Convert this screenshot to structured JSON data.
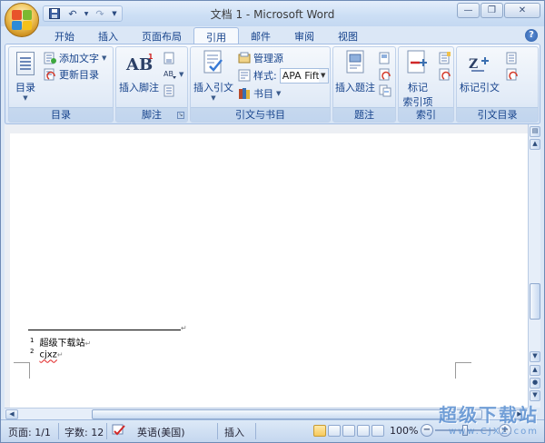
{
  "window": {
    "title": "文档 1 - Microsoft Word",
    "controls": [
      "minimize-icon",
      "restore-icon",
      "close-icon"
    ]
  },
  "quick_access": {
    "icons": [
      "save-icon",
      "undo-icon",
      "redo-icon",
      "customize-dropdown-icon"
    ]
  },
  "tabs": [
    {
      "label": "开始",
      "active": false
    },
    {
      "label": "插入",
      "active": false
    },
    {
      "label": "页面布局",
      "active": false
    },
    {
      "label": "引用",
      "active": true
    },
    {
      "label": "邮件",
      "active": false
    },
    {
      "label": "审阅",
      "active": false
    },
    {
      "label": "视图",
      "active": false
    }
  ],
  "ribbon": {
    "toc": {
      "group_label": "目录",
      "toc_button": "目录",
      "add_text": "添加文字",
      "update_toc": "更新目录"
    },
    "footnotes": {
      "group_label": "脚注",
      "insert_footnote": "插入脚注",
      "big_icon_text": "AB"
    },
    "citations": {
      "group_label": "引文与书目",
      "insert_citation": "插入引文",
      "manage_sources": "管理源",
      "style_label": "样式:",
      "style_value": "APA Fifth",
      "bibliography": "书目"
    },
    "captions": {
      "group_label": "题注",
      "insert_caption": "插入题注"
    },
    "index": {
      "group_label": "索引",
      "mark_entry_line1": "标记",
      "mark_entry_line2": "索引项"
    },
    "toa": {
      "group_label": "引文目录",
      "mark_citation": "标记引文"
    }
  },
  "document": {
    "footnotes": [
      {
        "number": "1",
        "text": "超级下载站"
      },
      {
        "number": "2",
        "text": "cjxz"
      }
    ],
    "paragraph_mark": "↵"
  },
  "statusbar": {
    "page": "页面: 1/1",
    "words": "字数: 12",
    "language": "英语(美国)",
    "insert_mode": "插入",
    "zoom": "100%"
  },
  "watermark": {
    "line1": "超级下载站",
    "line2": "www.CJXZ.com"
  },
  "colors": {
    "accent": "#15428b",
    "ribbon_bg": "#dbe7f6",
    "active_view": "#f7c95b"
  }
}
